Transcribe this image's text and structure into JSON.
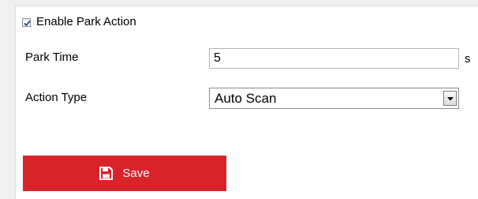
{
  "park_action": {
    "enable_label": "Enable Park Action",
    "enabled": true
  },
  "park_time": {
    "label": "Park Time",
    "value": "5",
    "unit": "s"
  },
  "action_type": {
    "label": "Action Type",
    "selected": "Auto Scan"
  },
  "save_button": {
    "label": "Save",
    "icon": "save-icon",
    "color": "#d9232a"
  },
  "colors": {
    "accent": "#d9232a",
    "background": "#ffffff",
    "page": "#f0f0f0"
  }
}
